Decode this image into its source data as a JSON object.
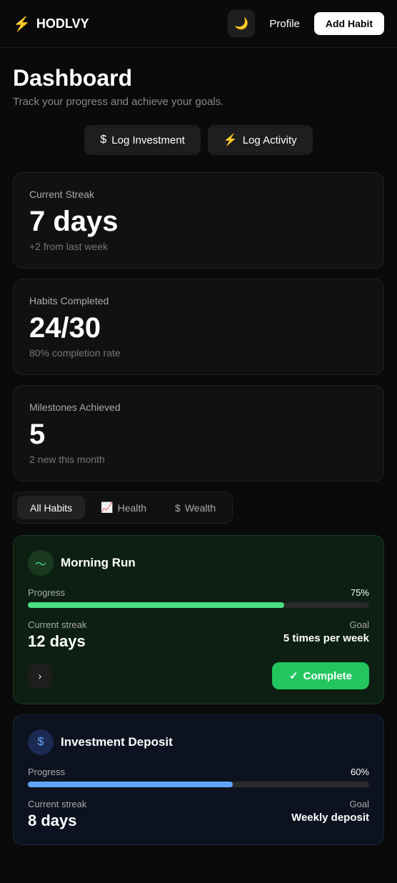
{
  "app": {
    "logo_text": "HODLVY",
    "logo_icon": "⚡"
  },
  "header": {
    "theme_icon": "🌙",
    "profile_label": "Profile",
    "add_habit_label": "Add Habit"
  },
  "dashboard": {
    "title": "Dashboard",
    "subtitle": "Track your progress and achieve your goals."
  },
  "actions": {
    "log_investment_label": "Log Investment",
    "log_investment_icon": "$",
    "log_activity_label": "Log Activity",
    "log_activity_icon": "⚡"
  },
  "stats": {
    "streak": {
      "label": "Current Streak",
      "value": "7 days",
      "sub": "+2 from last week"
    },
    "habits": {
      "label": "Habits Completed",
      "value": "24/30",
      "sub": "80% completion rate"
    },
    "milestones": {
      "label": "Milestones Achieved",
      "value": "5",
      "sub": "2 new this month"
    }
  },
  "tabs": [
    {
      "id": "all",
      "label": "All Habits",
      "icon": "",
      "active": true
    },
    {
      "id": "health",
      "label": "Health",
      "icon": "📈",
      "active": false
    },
    {
      "id": "wealth",
      "label": "Wealth",
      "icon": "$",
      "active": false
    }
  ],
  "habits": [
    {
      "id": "morning-run",
      "name": "Morning Run",
      "icon_symbol": "📈",
      "color": "green",
      "progress_label": "Progress",
      "progress_pct": "75%",
      "progress_value": 75,
      "streak_label": "Current streak",
      "streak_value": "12 days",
      "goal_label": "Goal",
      "goal_value": "5 times per week",
      "complete_label": "Complete"
    },
    {
      "id": "investment-deposit",
      "name": "Investment Deposit",
      "icon_symbol": "$",
      "color": "blue",
      "progress_label": "Progress",
      "progress_pct": "60%",
      "progress_value": 60,
      "streak_label": "Current streak",
      "streak_value": "8 days",
      "goal_label": "Goal",
      "goal_value": "Weekly deposit",
      "complete_label": "Complete"
    }
  ]
}
